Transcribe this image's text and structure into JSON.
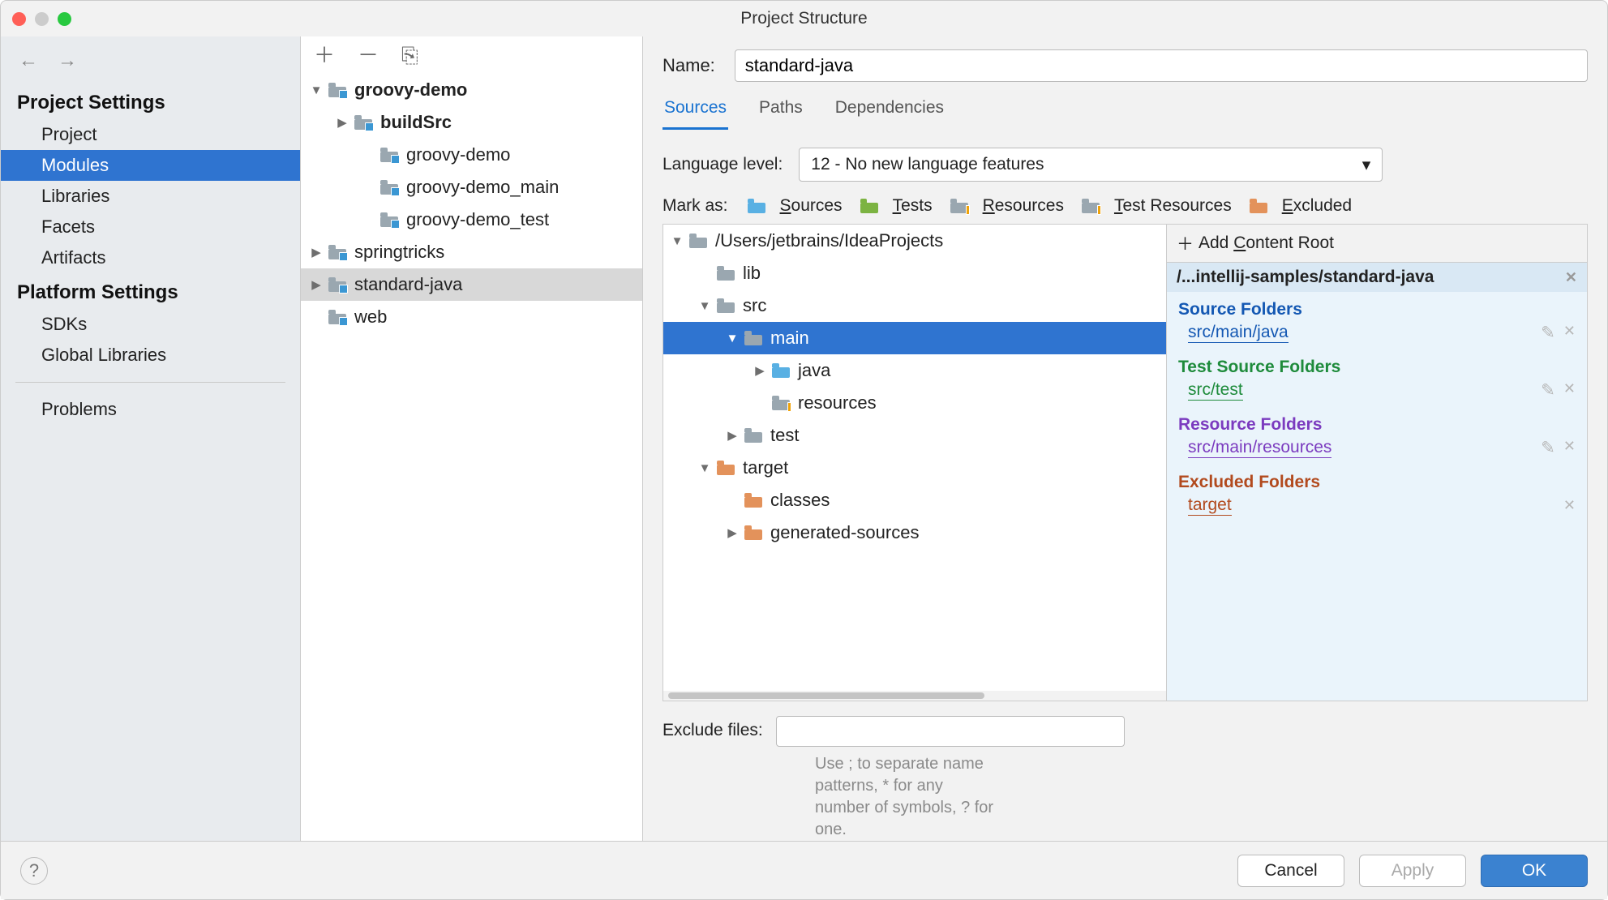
{
  "title": "Project Structure",
  "sidebar": {
    "group1": "Project Settings",
    "items1": [
      {
        "label": "Project"
      },
      {
        "label": "Modules",
        "selected": true
      },
      {
        "label": "Libraries"
      },
      {
        "label": "Facets"
      },
      {
        "label": "Artifacts"
      }
    ],
    "group2": "Platform Settings",
    "items2": [
      {
        "label": "SDKs"
      },
      {
        "label": "Global Libraries"
      }
    ],
    "problems": "Problems"
  },
  "moduleTree": [
    {
      "indent": 0,
      "expand": "▼",
      "icon": "module",
      "bold": true,
      "label": "groovy-demo"
    },
    {
      "indent": 1,
      "expand": "▶",
      "icon": "module",
      "bold": true,
      "label": "buildSrc"
    },
    {
      "indent": 2,
      "expand": "",
      "icon": "module",
      "bold": false,
      "label": "groovy-demo"
    },
    {
      "indent": 2,
      "expand": "",
      "icon": "module",
      "bold": false,
      "label": "groovy-demo_main"
    },
    {
      "indent": 2,
      "expand": "",
      "icon": "module",
      "bold": false,
      "label": "groovy-demo_test"
    },
    {
      "indent": 0,
      "expand": "▶",
      "icon": "module",
      "bold": false,
      "label": "springtricks"
    },
    {
      "indent": 0,
      "expand": "▶",
      "icon": "module",
      "bold": false,
      "label": "standard-java",
      "selected": true
    },
    {
      "indent": 0,
      "expand": "",
      "icon": "module",
      "bold": false,
      "label": "web"
    }
  ],
  "name_label": "Name:",
  "name_value": "standard-java",
  "tabs": [
    {
      "label": "Sources",
      "active": true
    },
    {
      "label": "Paths"
    },
    {
      "label": "Dependencies"
    }
  ],
  "lang_label": "Language level:",
  "lang_value": "12 - No new language features",
  "markas_label": "Mark as:",
  "marks": [
    {
      "label": "Sources",
      "color": "#59b0e3",
      "u": "S"
    },
    {
      "label": "Tests",
      "color": "#7cb342",
      "u": "T"
    },
    {
      "label": "Resources",
      "color": "#9aa7b0",
      "u": "R",
      "res": true
    },
    {
      "label": "Test Resources",
      "color": "#9aa7b0",
      "u": "T",
      "testres": true
    },
    {
      "label": "Excluded",
      "color": "#e3925b",
      "u": "E"
    }
  ],
  "srcTree": [
    {
      "indent": 0,
      "expand": "▼",
      "icon": "folder",
      "color": "#9aa7b0",
      "label": "/Users/jetbrains/IdeaProjects"
    },
    {
      "indent": 1,
      "expand": "",
      "icon": "folder",
      "color": "#9aa7b0",
      "label": "lib"
    },
    {
      "indent": 1,
      "expand": "▼",
      "icon": "folder",
      "color": "#9aa7b0",
      "label": "src"
    },
    {
      "indent": 2,
      "expand": "▼",
      "icon": "folder",
      "color": "#9aa7b0",
      "label": "main",
      "selected": true
    },
    {
      "indent": 3,
      "expand": "▶",
      "icon": "folder",
      "color": "#59b0e3",
      "label": "java"
    },
    {
      "indent": 3,
      "expand": "",
      "icon": "folder",
      "color": "#9aa7b0",
      "label": "resources",
      "res": true
    },
    {
      "indent": 2,
      "expand": "▶",
      "icon": "folder",
      "color": "#9aa7b0",
      "label": "test"
    },
    {
      "indent": 1,
      "expand": "▼",
      "icon": "folder",
      "color": "#e3925b",
      "label": "target"
    },
    {
      "indent": 2,
      "expand": "",
      "icon": "folder",
      "color": "#e3925b",
      "label": "classes"
    },
    {
      "indent": 2,
      "expand": "▶",
      "icon": "folder",
      "color": "#e3925b",
      "label": "generated-sources"
    }
  ],
  "add_content_root": "Add Content Root",
  "content_root_path": "/...intellij-samples/standard-java",
  "sections": [
    {
      "title": "Source Folders",
      "cls": "clr-source",
      "items": [
        {
          "label": "src/main/java",
          "edit": true,
          "close": true
        }
      ]
    },
    {
      "title": "Test Source Folders",
      "cls": "clr-test",
      "items": [
        {
          "label": "src/test",
          "edit": true,
          "close": true
        }
      ]
    },
    {
      "title": "Resource Folders",
      "cls": "clr-res",
      "items": [
        {
          "label": "src/main/resources",
          "edit": true,
          "close": true
        }
      ]
    },
    {
      "title": "Excluded Folders",
      "cls": "clr-exc",
      "items": [
        {
          "label": "target",
          "edit": false,
          "close": true
        }
      ]
    }
  ],
  "exclude_label": "Exclude files:",
  "exclude_hint": "Use ; to separate name patterns, * for any number of symbols, ? for one.",
  "buttons": {
    "cancel": "Cancel",
    "apply": "Apply",
    "ok": "OK"
  }
}
